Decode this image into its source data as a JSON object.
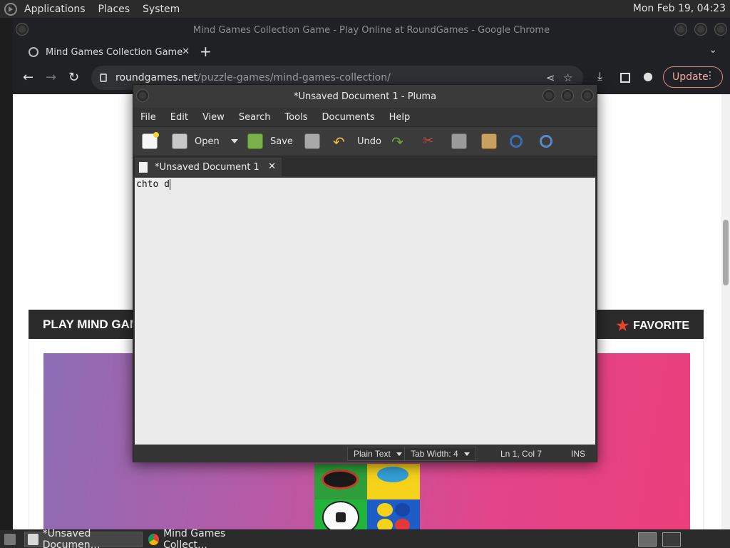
{
  "top_panel": {
    "menus": [
      "Applications",
      "Places",
      "System"
    ],
    "clock": "Mon Feb 19, 04:23"
  },
  "chrome": {
    "window_title": "Mind Games Collection Game - Play Online at RoundGames - Google Chrome",
    "tab_title": "Mind Games Collection Game",
    "tab_close": "✕",
    "new_tab": "+",
    "tab_menu": "⌄",
    "url_domain": "roundgames.net",
    "url_path": "/puzzle-games/mind-games-collection/",
    "update_label": "Update"
  },
  "page": {
    "game_title": "PLAY MIND GAMES COLLECTION",
    "favorite_label": "FAVORITE"
  },
  "pluma": {
    "window_title": "*Unsaved Document 1 - Pluma",
    "menus": [
      "File",
      "Edit",
      "View",
      "Search",
      "Tools",
      "Documents",
      "Help"
    ],
    "toolbar": {
      "open_label": "Open",
      "save_label": "Save",
      "undo_label": "Undo"
    },
    "doc_tab_title": "*Unsaved Document 1",
    "doc_tab_close": "✕",
    "editor_text": "chto d",
    "status": {
      "language": "Plain Text",
      "tab_width": "Tab Width:  4",
      "position": "Ln 1, Col 7",
      "mode": "INS"
    }
  },
  "taskbar": {
    "tasks": [
      "*Unsaved Documen…",
      "Mind Games Collect…"
    ]
  },
  "colors": {
    "chrome_bg": "#202124",
    "omnibox_bg": "#303134",
    "update_accent": "#e08a80",
    "favorite_star": "#e8442c",
    "editor_bg": "#ebebeb"
  }
}
